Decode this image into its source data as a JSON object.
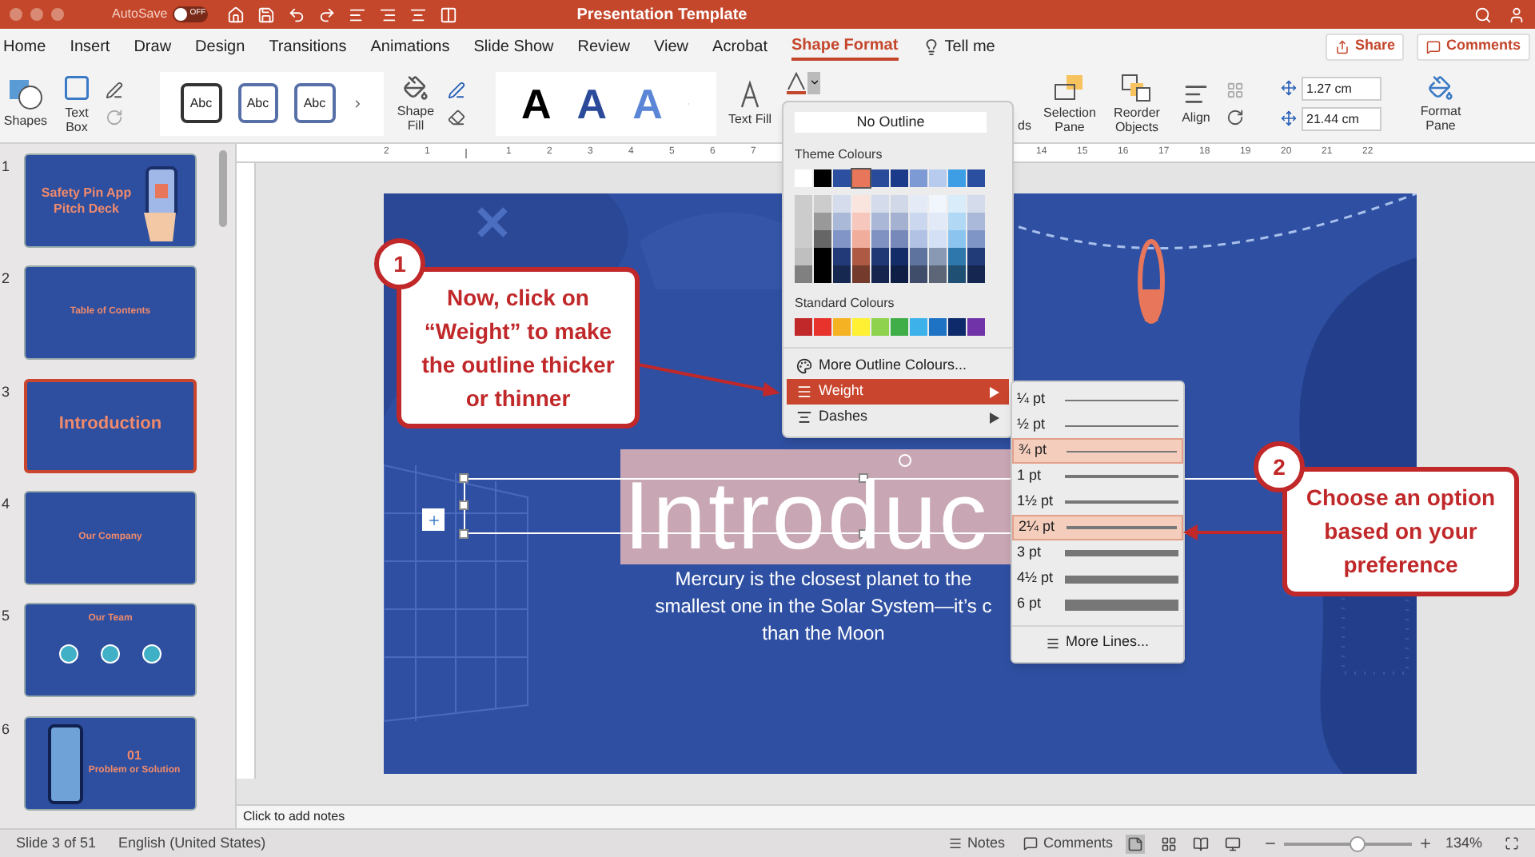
{
  "title_bar": {
    "autosave_label": "AutoSave",
    "autosave_state": "OFF",
    "autosave_on": false,
    "title": "Presentation Template"
  },
  "tabs": [
    {
      "label": "Home",
      "selected": false
    },
    {
      "label": "Insert",
      "selected": false
    },
    {
      "label": "Draw",
      "selected": false
    },
    {
      "label": "Design",
      "selected": false
    },
    {
      "label": "Transitions",
      "selected": false
    },
    {
      "label": "Animations",
      "selected": false
    },
    {
      "label": "Slide Show",
      "selected": false
    },
    {
      "label": "Review",
      "selected": false
    },
    {
      "label": "View",
      "selected": false
    },
    {
      "label": "Acrobat",
      "selected": false
    },
    {
      "label": "Shape Format",
      "selected": true
    }
  ],
  "tell_me": "Tell me",
  "share": "Share",
  "comments": "Comments",
  "ribbon": {
    "shapes": "Shapes",
    "text_box": "Text Box",
    "shape_styles": [
      "Abc",
      "Abc",
      "Abc"
    ],
    "shape_fill": "Shape Fill",
    "wordart": [
      "A",
      "A",
      "A"
    ],
    "text_fill": "Text Fill",
    "partial_label": "ds",
    "selection_pane": "Selection Pane",
    "reorder_objects": "Reorder Objects",
    "align": "Align",
    "height": "1.27 cm",
    "width": "21.44 cm",
    "format_pane": "Format Pane"
  },
  "ruler": {
    "left_numbers": [
      "2",
      "1"
    ],
    "middle_numbers": [
      "1",
      "2",
      "3",
      "4",
      "5",
      "6",
      "7"
    ],
    "right_numbers": [
      "14",
      "15",
      "16",
      "17",
      "18",
      "19",
      "20",
      "21",
      "22"
    ]
  },
  "thumbnails": [
    {
      "number": "1",
      "title": "Safety Pin App Pitch Deck",
      "selected": false
    },
    {
      "number": "2",
      "title": "Table of Contents",
      "selected": false
    },
    {
      "number": "3",
      "title": "Introduction",
      "selected": true
    },
    {
      "number": "4",
      "title": "Our Company",
      "selected": false
    },
    {
      "number": "5",
      "title": "Our Team",
      "selected": false
    },
    {
      "number": "6",
      "title": "01",
      "subtitle": "Problem or Solution",
      "selected": false
    }
  ],
  "slide": {
    "title": "Introduc",
    "subtitle_lines": [
      "Mercury is the closest planet to the",
      "smallest one in the Solar System—it’s c",
      "than the Moon"
    ]
  },
  "outline_menu": {
    "no_outline": "No Outline",
    "theme_label": "Theme Colours",
    "theme_colours": [
      {
        "color": "#ffffff",
        "selected": false
      },
      {
        "color": "#000000",
        "selected": false
      },
      {
        "color": "#2d4fa0",
        "selected": false
      },
      {
        "color": "#e8765a",
        "selected": true
      },
      {
        "color": "#2a4a9a",
        "selected": false
      },
      {
        "color": "#1b3b8a",
        "selected": false
      },
      {
        "color": "#7d9ad4",
        "selected": false
      },
      {
        "color": "#b7cbee",
        "selected": false
      },
      {
        "color": "#3d9ee5",
        "selected": false
      },
      {
        "color": "#2a4ea0",
        "selected": false
      }
    ],
    "standard_label": "Standard Colours",
    "standard_colours": [
      {
        "color": "#c0282a"
      },
      {
        "color": "#e8322c"
      },
      {
        "color": "#f5b324"
      },
      {
        "color": "#fff033"
      },
      {
        "color": "#8fd24e"
      },
      {
        "color": "#3fae49"
      },
      {
        "color": "#3cb1ea"
      },
      {
        "color": "#1f73c4"
      },
      {
        "color": "#0e2a6a"
      },
      {
        "color": "#7134a8"
      }
    ],
    "items": [
      {
        "label": "More Outline Colours...",
        "kind": "colours",
        "selected": false
      },
      {
        "label": "Weight",
        "kind": "weight",
        "selected": true
      },
      {
        "label": "Dashes",
        "kind": "dashes",
        "selected": false
      }
    ]
  },
  "weight_menu": {
    "items": [
      {
        "label": "¼ pt",
        "highlighted": false
      },
      {
        "label": "½ pt",
        "highlighted": false
      },
      {
        "label": "¾ pt",
        "highlighted": true
      },
      {
        "label": "1 pt",
        "highlighted": false
      },
      {
        "label": "1½ pt",
        "highlighted": false
      },
      {
        "label": "2¼ pt",
        "highlighted": true
      },
      {
        "label": "3 pt",
        "highlighted": false
      },
      {
        "label": "4½ pt",
        "highlighted": false
      },
      {
        "label": "6 pt",
        "highlighted": false
      }
    ],
    "more": "More Lines..."
  },
  "callouts": [
    {
      "number": "1",
      "text": "Now, click on “Weight” to make the outline thicker or thinner"
    },
    {
      "number": "2",
      "text": "Choose an option based on your preference"
    }
  ],
  "notes": {
    "placeholder": "Click to add notes"
  },
  "status_bar": {
    "slide": "Slide 3 of 51",
    "language": "English (United States)",
    "notes": "Notes",
    "comments": "Comments",
    "zoom": "134%",
    "level": 0.58
  }
}
